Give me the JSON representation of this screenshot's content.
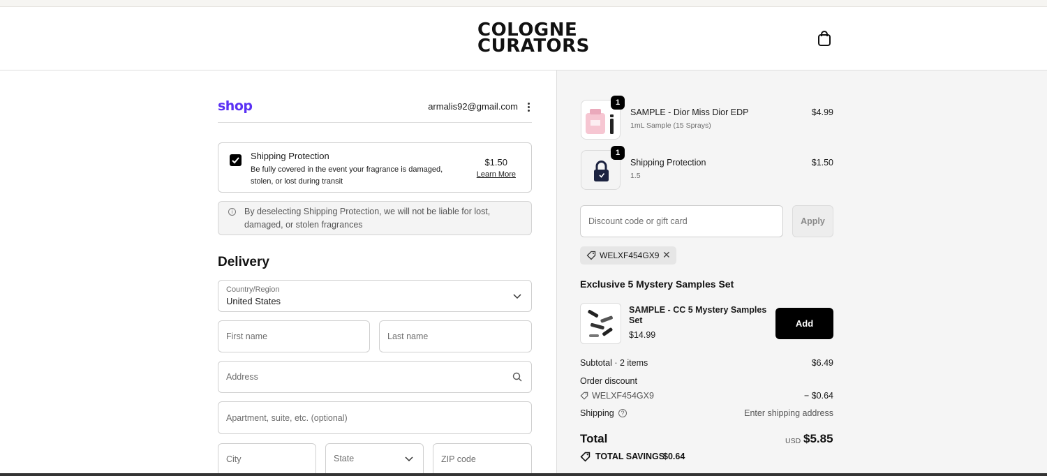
{
  "header": {
    "logo_line1": "COLOGNE",
    "logo_line2": "CURATORS",
    "bag_icon": "shopping-bag-icon"
  },
  "account": {
    "shop_label": "shop",
    "email": "armalis92@gmail.com",
    "menu_icon": "kebab-menu-icon"
  },
  "shipping_protection": {
    "checked": true,
    "title": "Shipping Protection",
    "description": "Be fully covered in the event your fragrance is damaged, stolen, or lost during transit",
    "price": "$1.50",
    "learn_more": "Learn More"
  },
  "notice": {
    "text": "By deselecting Shipping Protection, we will not be liable for lost, damaged, or stolen fragrances"
  },
  "delivery": {
    "heading": "Delivery",
    "country_label": "Country/Region",
    "country_value": "United States",
    "first_name_placeholder": "First name",
    "last_name_placeholder": "Last name",
    "address_placeholder": "Address",
    "apartment_placeholder": "Apartment, suite, etc. (optional)",
    "city_placeholder": "City",
    "state_placeholder": "State",
    "zip_placeholder": "ZIP code"
  },
  "cart": {
    "items": [
      {
        "qty": "1",
        "name": "SAMPLE - Dior Miss Dior EDP",
        "variant": "1mL Sample (15 Sprays)",
        "price": "$4.99"
      },
      {
        "qty": "1",
        "name": "Shipping Protection",
        "variant": "1.5",
        "price": "$1.50"
      }
    ],
    "discount_placeholder": "Discount code or gift card",
    "apply_label": "Apply",
    "applied_code": "WELXF454GX9"
  },
  "upsell": {
    "heading": "Exclusive 5 Mystery Samples Set",
    "name": "SAMPLE - CC 5 Mystery Samples Set",
    "price": "$14.99",
    "add_label": "Add"
  },
  "summary": {
    "subtotal_label": "Subtotal · 2 items",
    "subtotal_value": "$6.49",
    "order_discount_label": "Order discount",
    "discount_code": "WELXF454GX9",
    "discount_value": "− $0.64",
    "shipping_label": "Shipping",
    "shipping_value": "Enter shipping address",
    "total_label": "Total",
    "currency": "USD",
    "total_value": "$5.85",
    "savings_label": "TOTAL SAVINGS",
    "savings_value": "$0.64"
  }
}
